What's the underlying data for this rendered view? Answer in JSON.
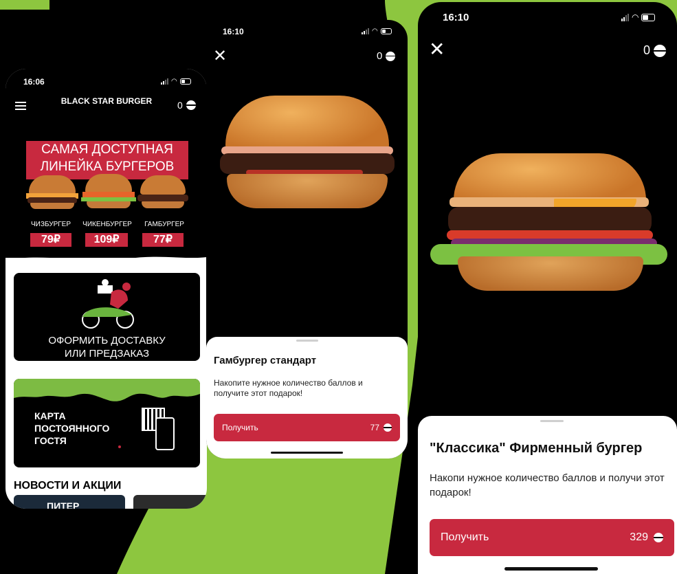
{
  "phone1": {
    "status_time": "16:06",
    "app_title": "BLACK STAR BURGER",
    "points": "0",
    "promo": {
      "line1": "САМАЯ ДОСТУПНАЯ",
      "line2": "ЛИНЕЙКА БУРГЕРОВ",
      "items": [
        {
          "name": "ЧИЗБУРГЕР",
          "price": "79₽"
        },
        {
          "name": "ЧИКЕНБУРГЕР",
          "price": "109₽"
        },
        {
          "name": "ГАМБУРГЕР",
          "price": "77₽"
        }
      ]
    },
    "delivery": {
      "line1": "ОФОРМИТЬ ДОСТАВКУ",
      "line2": "ИЛИ ПРЕДЗАКАЗ"
    },
    "loyalty": {
      "line1": "КАРТА",
      "line2": "ПОСТОЯННОГО",
      "line3": "ГОСТЯ"
    },
    "news_heading": "НОВОСТИ И АКЦИИ",
    "news_card": "ПИТЕР"
  },
  "phone2": {
    "status_time": "16:10",
    "points": "0",
    "title": "Гамбургер стандарт",
    "description": "Накопите нужное количество баллов и получите этот подарок!",
    "button_label": "Получить",
    "cost": "77"
  },
  "phone3": {
    "status_time": "16:10",
    "points": "0",
    "title": "\"Классика\" Фирменный бургер",
    "description": "Накопи нужное количество баллов и получи этот подарок!",
    "button_label": "Получить",
    "cost": "329"
  },
  "colors": {
    "accent": "#c8293f",
    "green": "#8dc63f",
    "bun": "#d98a3a"
  }
}
